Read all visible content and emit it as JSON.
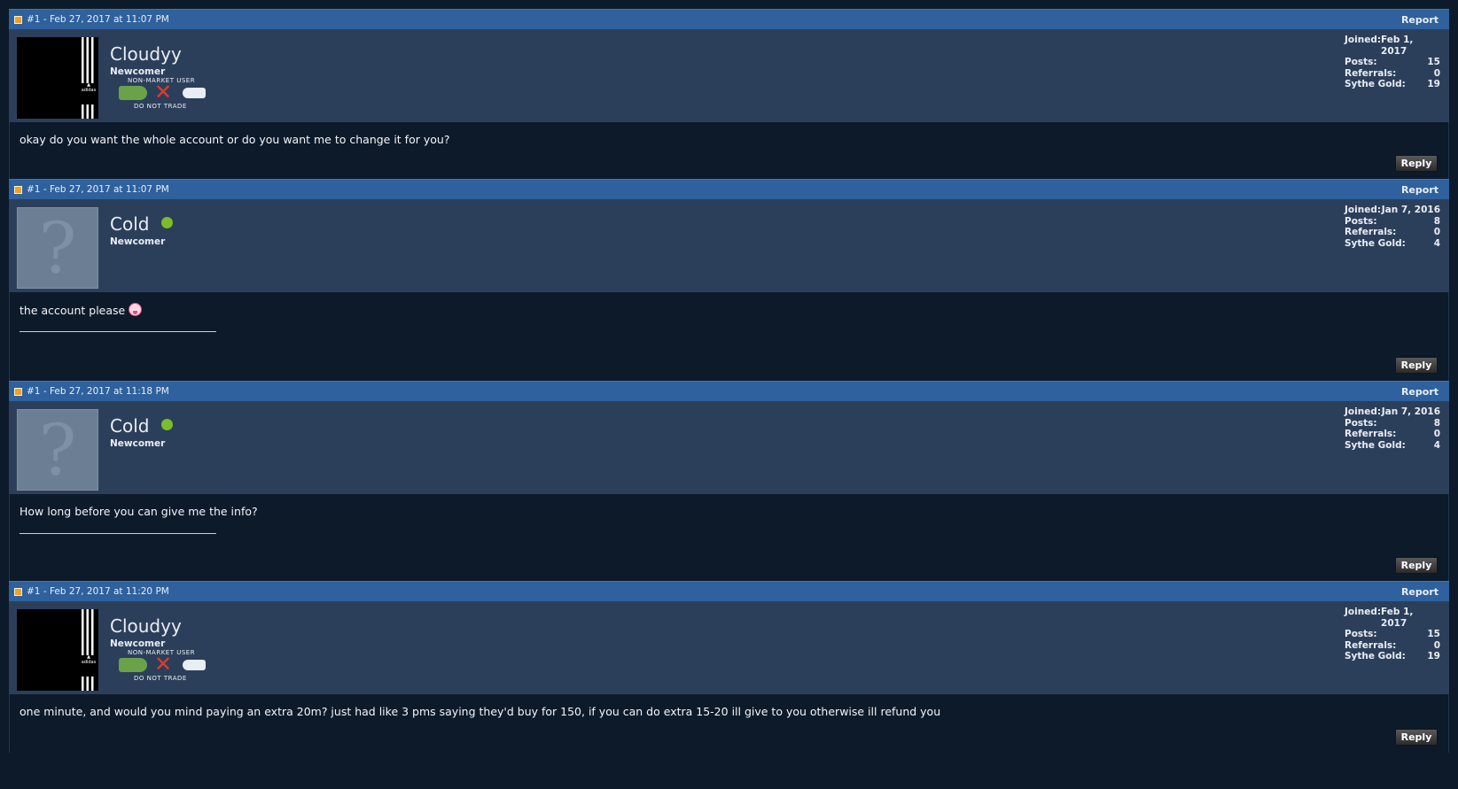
{
  "posts": [
    {
      "meta": "#1 - Feb 27, 2017 at 11:07 PM",
      "report": "Report",
      "user": "Cloudyy",
      "avatar": "adidas-avatar",
      "online": false,
      "rank": "Newcomer",
      "badge": {
        "top": "NON-MARKET USER",
        "bottom": "DO NOT TRADE"
      },
      "stats": {
        "joined": "Feb 1, 2017",
        "posts": "15",
        "referrals": "0",
        "gold": "19"
      },
      "message": "okay do you want the whole account or do you want me to change it for you?",
      "signature": false,
      "reply": "Reply"
    },
    {
      "meta": "#1 - Feb 27, 2017 at 11:07 PM",
      "report": "Report",
      "user": "Cold",
      "avatar": "default-avatar",
      "online": true,
      "rank": "Newcomer",
      "stats": {
        "joined": "Jan 7, 2016",
        "posts": "8",
        "referrals": "0",
        "gold": "4"
      },
      "message": "the account please",
      "emoji": "tongue-emoji",
      "signature": true,
      "reply": "Reply"
    },
    {
      "meta": "#1 - Feb 27, 2017 at 11:18 PM",
      "report": "Report",
      "user": "Cold",
      "avatar": "default-avatar",
      "online": true,
      "rank": "Newcomer",
      "stats": {
        "joined": "Jan 7, 2016",
        "posts": "8",
        "referrals": "0",
        "gold": "4"
      },
      "message": "How long before you can give me the info?",
      "signature": true,
      "reply": "Reply"
    },
    {
      "meta": "#1 - Feb 27, 2017 at 11:20 PM",
      "report": "Report",
      "user": "Cloudyy",
      "avatar": "adidas-avatar",
      "online": false,
      "rank": "Newcomer",
      "badge": {
        "top": "NON-MARKET USER",
        "bottom": "DO NOT TRADE"
      },
      "stats": {
        "joined": "Feb 1, 2017",
        "posts": "15",
        "referrals": "0",
        "gold": "19"
      },
      "message": "one minute, and would you mind paying an extra 20m? just had like 3 pms saying they'd buy for 150, if you can do extra 15-20 ill give to you otherwise ill refund you",
      "signature": false,
      "reply": "Reply"
    }
  ],
  "labels": {
    "joined": "Joined:",
    "posts": "Posts:",
    "referrals": "Referrals:",
    "gold": "Sythe Gold:"
  },
  "colors": {
    "header": "#2e619d",
    "userbar": "#2c3f5a",
    "body": "#0d1a2a",
    "online": "#7cbd2a"
  }
}
